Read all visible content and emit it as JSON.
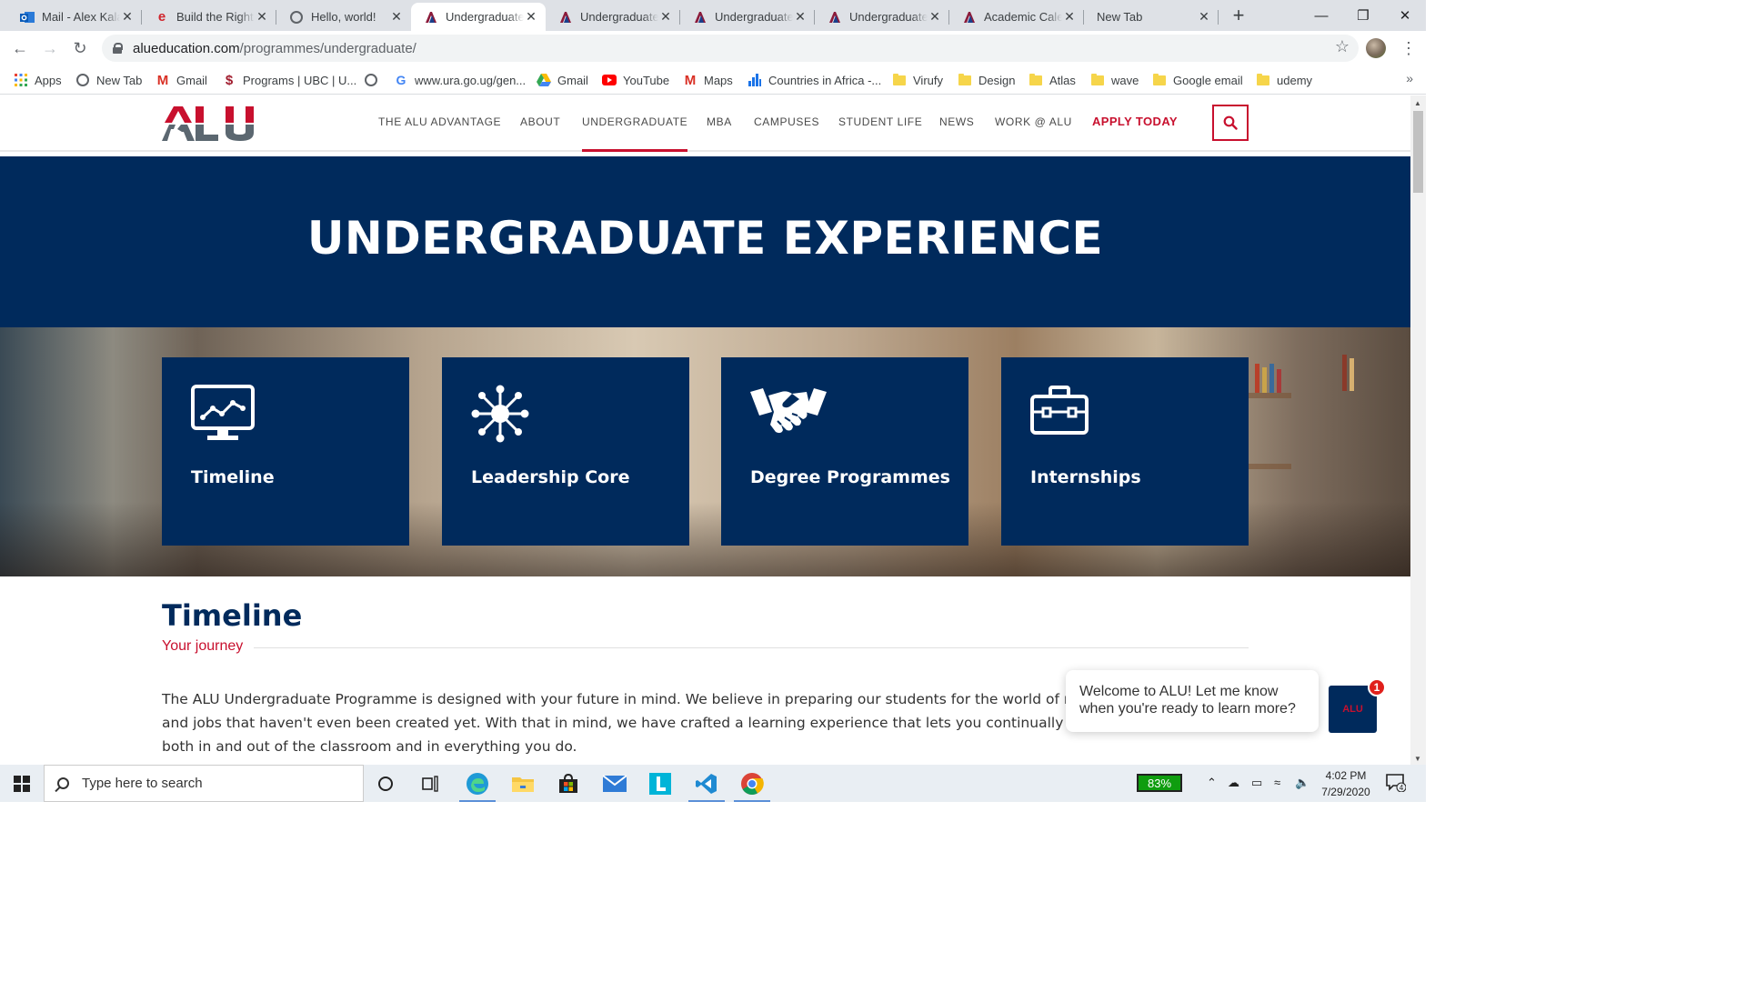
{
  "browser": {
    "tabs": [
      {
        "title": "Mail - Alex Kala",
        "favicon": "outlook-icon",
        "active": false
      },
      {
        "title": "Build the Right",
        "favicon": "e-logo-icon",
        "active": false
      },
      {
        "title": "Hello, world!",
        "favicon": "globe-icon",
        "active": false
      },
      {
        "title": "Undergraduate",
        "favicon": "alu-icon",
        "active": true
      },
      {
        "title": "Undergraduate",
        "favicon": "alu-icon",
        "active": false
      },
      {
        "title": "Undergraduate",
        "favicon": "alu-icon",
        "active": false
      },
      {
        "title": "Undergraduate",
        "favicon": "alu-icon",
        "active": false
      },
      {
        "title": "Academic Calen",
        "favicon": "alu-icon",
        "active": false
      },
      {
        "title": "New Tab",
        "favicon": "",
        "active": false
      }
    ],
    "url_host": "alueducation.com",
    "url_path": "/programmes/undergraduate/",
    "bookmarks": [
      {
        "label": "Apps",
        "icon": "apps-grid-icon"
      },
      {
        "label": "New Tab",
        "icon": "globe-icon"
      },
      {
        "label": "Gmail",
        "icon": "gmail-icon"
      },
      {
        "label": "Programs | UBC | U...",
        "icon": "ubc-icon"
      },
      {
        "label": "",
        "icon": "globe-icon"
      },
      {
        "label": "www.ura.go.ug/gen...",
        "icon": "google-icon"
      },
      {
        "label": "Gmail",
        "icon": "drive-icon"
      },
      {
        "label": "YouTube",
        "icon": "youtube-icon"
      },
      {
        "label": "Maps",
        "icon": "gmail-icon"
      },
      {
        "label": "Countries in Africa -...",
        "icon": "bar-chart-icon"
      },
      {
        "label": "Virufy",
        "icon": "folder-icon"
      },
      {
        "label": "Design",
        "icon": "folder-icon"
      },
      {
        "label": "Atlas",
        "icon": "folder-icon"
      },
      {
        "label": "wave",
        "icon": "folder-icon"
      },
      {
        "label": "Google email",
        "icon": "folder-icon"
      },
      {
        "label": "udemy",
        "icon": "folder-icon"
      }
    ]
  },
  "site": {
    "logo_text": "ALU",
    "nav": [
      "THE ALU ADVANTAGE",
      "ABOUT",
      "UNDERGRADUATE",
      "MBA",
      "CAMPUSES",
      "STUDENT LIFE",
      "NEWS",
      "WORK @ ALU"
    ],
    "nav_current": "UNDERGRADUATE",
    "apply_label": "APPLY TODAY",
    "hero_title": "UNDERGRADUATE EXPERIENCE",
    "cards": [
      {
        "label": "Timeline",
        "icon": "monitor-chart-icon"
      },
      {
        "label": "Leadership Core",
        "icon": "network-hub-icon"
      },
      {
        "label": "Degree Programmes",
        "icon": "handshake-icon"
      },
      {
        "label": "Internships",
        "icon": "briefcase-icon"
      }
    ],
    "section_title": "Timeline",
    "section_subtitle": "Your journey",
    "paragraph": "The ALU Undergraduate Programme is designed with your future in mind. We believe in preparing our students for the world of new ideas, big challenges and jobs that haven't even been created yet. With that in mind, we have crafted a learning experience that lets you continually apply the skills you learn, both in and out of the classroom and in everything you do.",
    "chat_message": "Welcome to ALU! Let me know when you're ready to learn more?",
    "chat_badge": "1",
    "chat_logo": "ALU"
  },
  "taskbar": {
    "search_placeholder": "Type here to search",
    "battery": "83%",
    "time": "4:02 PM",
    "date": "7/29/2020",
    "notification_count": "4"
  },
  "colors": {
    "navy": "#002a5c",
    "red": "#c8102e"
  }
}
